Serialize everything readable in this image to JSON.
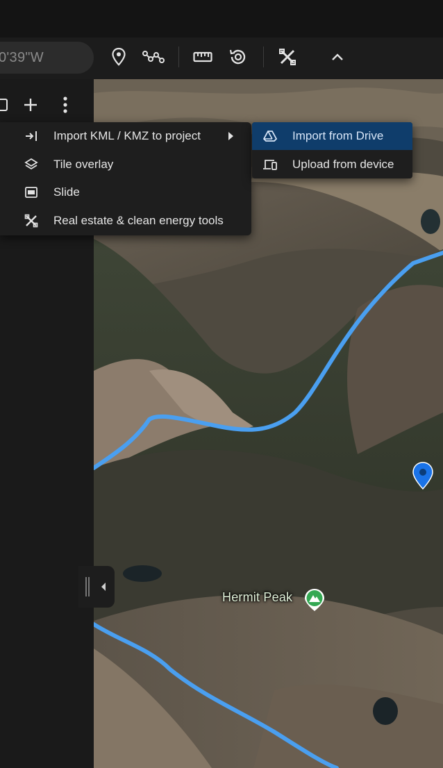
{
  "toolbar": {
    "coordinate_text": "0'39\"W",
    "icons": [
      "place-marker-icon",
      "path-icon",
      "ruler-icon",
      "history-icon",
      "tools-icon",
      "chevron-up-icon"
    ]
  },
  "sidebar": {
    "icons": [
      "collapse-panel-icon",
      "add-icon",
      "more-options-icon"
    ]
  },
  "menu": {
    "items": [
      {
        "label": "Import KML / KMZ to project",
        "icon": "import-icon",
        "has_submenu": true
      },
      {
        "label": "Tile overlay",
        "icon": "layers-icon"
      },
      {
        "label": "Slide",
        "icon": "slide-icon"
      },
      {
        "label": "Real estate & clean energy tools",
        "icon": "tools-icon"
      }
    ]
  },
  "submenu": {
    "items": [
      {
        "label": "Import from Drive",
        "icon": "drive-icon",
        "highlighted": true
      },
      {
        "label": "Upload from device",
        "icon": "devices-icon"
      }
    ]
  },
  "map": {
    "peak_label": "Hermit Peak"
  },
  "colors": {
    "accent_highlight": "#0f3d6b",
    "route_line": "#4a9ff0",
    "pin": "#1a73e8",
    "peak_marker": "#34a853"
  }
}
